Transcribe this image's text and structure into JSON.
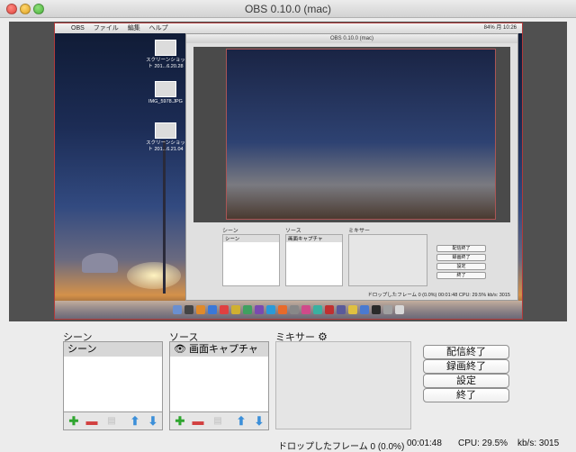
{
  "window": {
    "title": "OBS 0.10.0 (mac)"
  },
  "preview": {
    "menubar": {
      "items": [
        "OBS",
        "ファイル",
        "編集",
        "ヘルプ"
      ],
      "right": "84% 月 10:26"
    },
    "desktop_files": [
      {
        "label": "スクリーンショット 201...6.20.28"
      },
      {
        "label": "IMG_5978.JPG"
      },
      {
        "label": "スクリーンショット 201...6.21.04"
      }
    ],
    "nested": {
      "title": "OBS 0.10.0 (mac)",
      "scene_label": "シーン",
      "source_label": "ソース",
      "mixer_label": "ミキサー",
      "scene_item": "シーン",
      "source_item": "画面キャプチャ",
      "buttons": [
        "配信終了",
        "録画終了",
        "設定",
        "終了"
      ],
      "status": "ドロップしたフレーム 0 (0.0%)    00:01:48    CPU: 29.5%    kb/s: 3015"
    }
  },
  "panels": {
    "scenes": {
      "label": "シーン",
      "items": [
        "シーン"
      ]
    },
    "sources": {
      "label": "ソース",
      "items": [
        "画面キャプチャ"
      ]
    },
    "mixer": {
      "label": "ミキサー"
    }
  },
  "controls": {
    "stop_streaming": "配信終了",
    "stop_recording": "録画終了",
    "settings": "設定",
    "exit": "終了"
  },
  "status": {
    "dropped_frames": "ドロップしたフレーム 0 (0.0%)",
    "time": "00:01:48",
    "cpu": "CPU: 29.5%",
    "kbps": "kb/s: 3015"
  }
}
